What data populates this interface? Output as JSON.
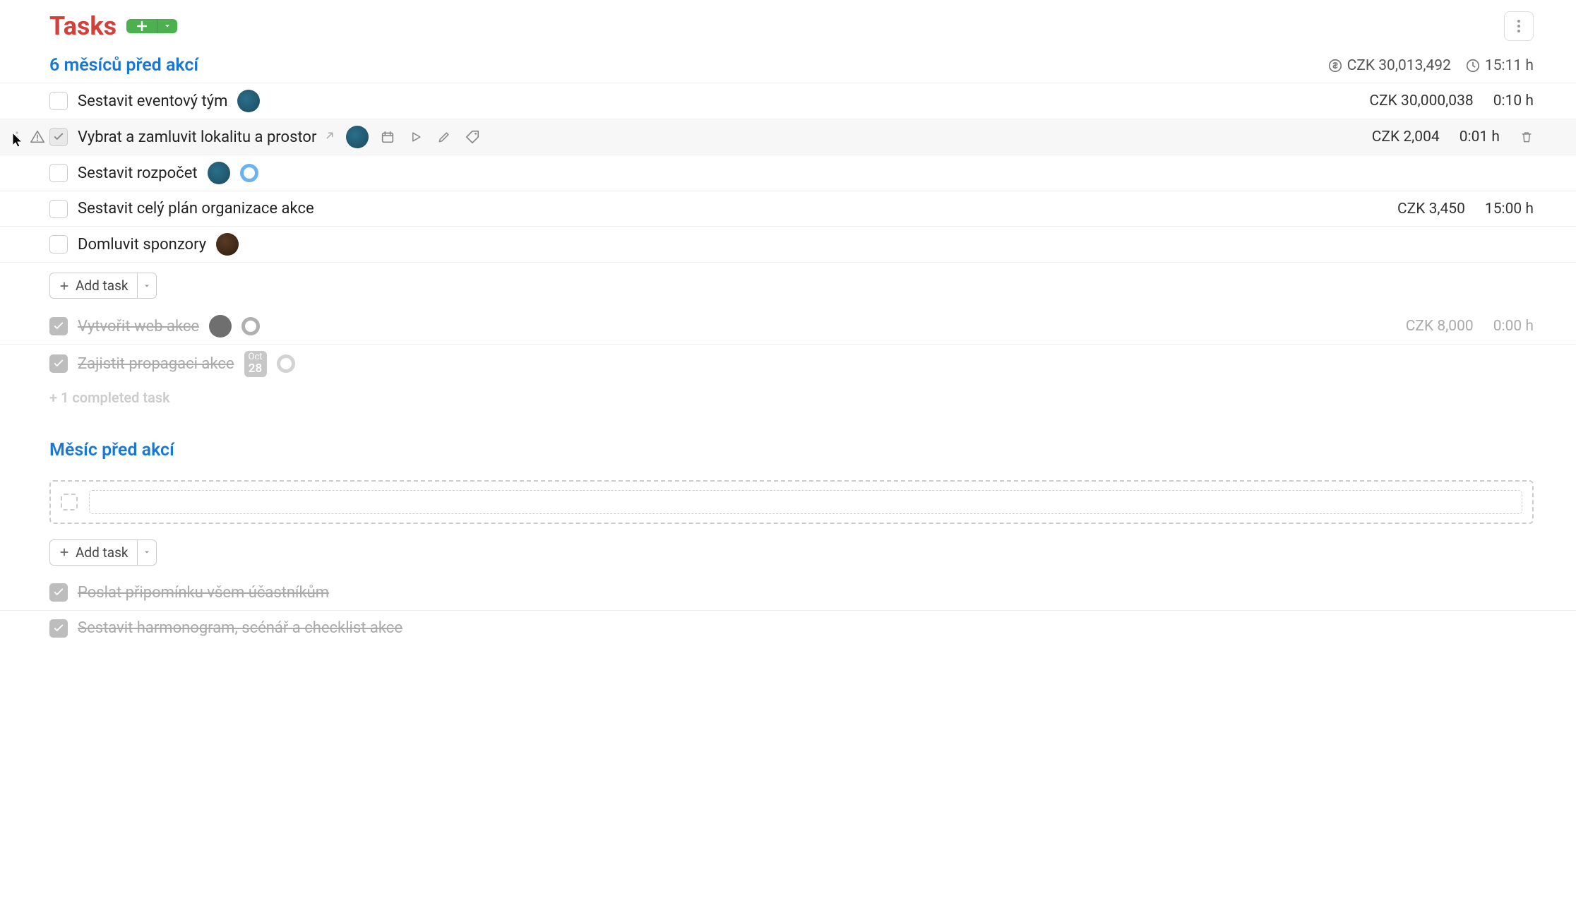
{
  "header": {
    "title": "Tasks"
  },
  "group1": {
    "title": "6 měsíců před akcí",
    "total_cost": "CZK 30,013,492",
    "total_time": "15:11 h",
    "tasks": [
      {
        "title": "Sestavit eventový tým",
        "cost": "CZK 30,000,038",
        "time": "0:10 h"
      },
      {
        "title": "Vybrat a zamluvit lokalitu a prostor",
        "cost": "CZK 2,004",
        "time": "0:01 h"
      },
      {
        "title": "Sestavit rozpočet"
      },
      {
        "title": "Sestavit celý plán organizace akce",
        "cost": "CZK 3,450",
        "time": "15:00 h"
      },
      {
        "title": "Domluvit sponzory"
      }
    ],
    "add_task_label": "Add task",
    "completed": [
      {
        "title": "Vytvořit web akce",
        "cost": "CZK 8,000",
        "time": "0:00 h"
      },
      {
        "title": "Zajistit propagaci akce",
        "month": "Oct",
        "day": "28"
      }
    ],
    "more_completed": "+ 1 completed task"
  },
  "group2": {
    "title": "Měsíc před akcí",
    "add_task_label": "Add task",
    "completed": [
      {
        "title": "Poslat připomínku všem účastníkům"
      },
      {
        "title": "Sestavit harmonogram, scénář a checklist akce"
      }
    ]
  }
}
